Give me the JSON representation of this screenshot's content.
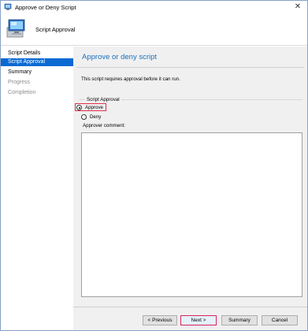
{
  "window": {
    "title": "Approve or Deny Script",
    "close_glyph": "✕",
    "app_icon": "script-icon"
  },
  "header": {
    "title": "Script Approval",
    "icon": "computer-monitor-icon"
  },
  "sidebar": {
    "items": [
      {
        "label": "Script Details",
        "state": "normal"
      },
      {
        "label": "Script Approval",
        "state": "active"
      },
      {
        "label": "Summary",
        "state": "normal"
      },
      {
        "label": "Progress",
        "state": "disabled"
      },
      {
        "label": "Completion",
        "state": "disabled"
      }
    ]
  },
  "main": {
    "title": "Approve or deny script",
    "intro": "This script requires approval before it can run.",
    "group_label": "Script Approval",
    "options": {
      "approve": "Approve",
      "deny": "Deny",
      "selected": "Approve"
    },
    "comment_label": "Approver comment:",
    "comment_value": ""
  },
  "footer": {
    "previous_label": "< Previous",
    "next_label": "Next >",
    "summary_label": "Summary",
    "cancel_label": "Cancel"
  },
  "colors": {
    "accent": "#0a6ad2",
    "title_blue": "#1a6fc0",
    "highlight_border": "#e0304a"
  }
}
